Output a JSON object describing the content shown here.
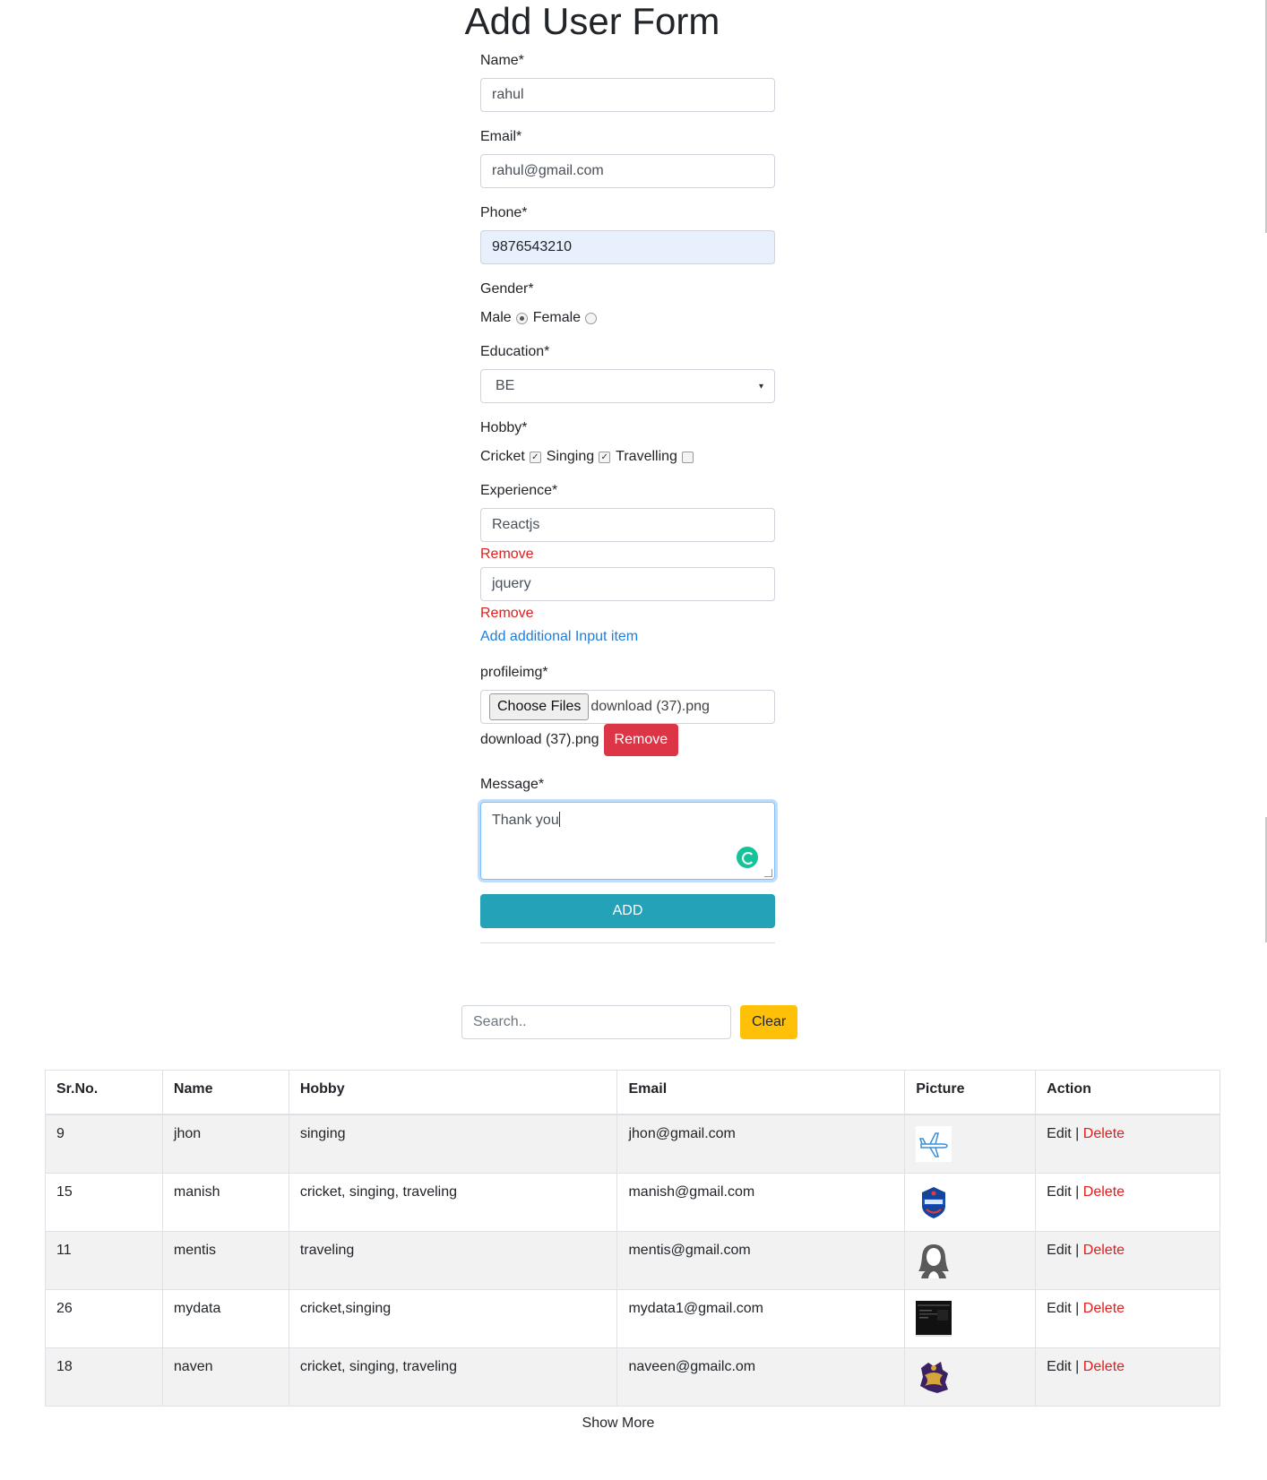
{
  "form": {
    "title": "Add User Form",
    "name_label": "Name*",
    "name_value": "rahul",
    "email_label": "Email*",
    "email_value": "rahul@gmail.com",
    "phone_label": "Phone*",
    "phone_value": "9876543210",
    "gender_label": "Gender*",
    "gender_options": [
      "Male",
      "Female"
    ],
    "gender_selected": "Male",
    "education_label": "Education*",
    "education_value": "BE",
    "hobby_label": "Hobby*",
    "hobbies": [
      {
        "label": "Cricket",
        "checked": true
      },
      {
        "label": "Singing",
        "checked": true
      },
      {
        "label": "Travelling",
        "checked": false
      }
    ],
    "experience_label": "Experience*",
    "experience_items": [
      "Reactjs",
      "jquery"
    ],
    "remove_label": "Remove",
    "add_item_label": "Add additional Input item",
    "profileimg_label": "profileimg*",
    "choose_files_label": "Choose Files",
    "file_name": "download (37).png",
    "file_remove_label": "Remove",
    "message_label": "Message*",
    "message_value": "Thank you",
    "submit_label": "ADD"
  },
  "search": {
    "placeholder": "Search..",
    "clear_label": "Clear"
  },
  "table": {
    "headers": [
      "Sr.No.",
      "Name",
      "Hobby",
      "Email",
      "Picture",
      "Action"
    ],
    "rows": [
      {
        "sr": "9",
        "name": "jhon",
        "hobby": "singing",
        "email": "jhon@gmail.com",
        "picture": "airplane-icon"
      },
      {
        "sr": "15",
        "name": "manish",
        "hobby": "cricket, singing, traveling",
        "email": "manish@gmail.com",
        "picture": "delhi-capitals-logo"
      },
      {
        "sr": "11",
        "name": "mentis",
        "hobby": "traveling",
        "email": "mentis@gmail.com",
        "picture": "female-avatar-icon"
      },
      {
        "sr": "26",
        "name": "mydata",
        "hobby": "cricket,singing",
        "email": "mydata1@gmail.com",
        "picture": "screenshot-thumbnail"
      },
      {
        "sr": "18",
        "name": "naven",
        "hobby": "cricket, singing, traveling",
        "email": "naveen@gmailc.om",
        "picture": "knight-riders-logo"
      }
    ],
    "edit_label": "Edit",
    "separator": "|",
    "delete_label": "Delete"
  },
  "show_more_label": "Show More",
  "colors": {
    "accent_add": "#23a2b8",
    "danger": "#dc3545",
    "warning": "#ffc107",
    "link_blue": "#1a7fe0",
    "link_red": "#e31c1c"
  }
}
